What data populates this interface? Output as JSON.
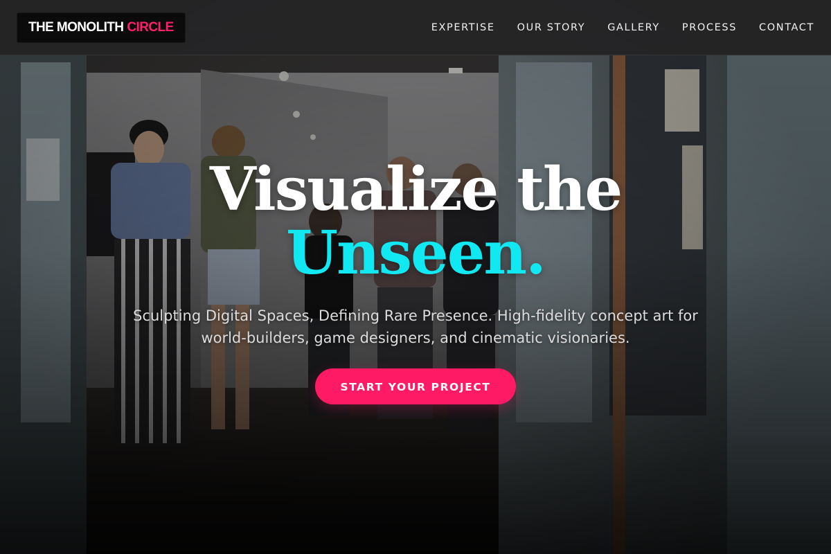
{
  "header": {
    "logo_primary": "THE MONOLITH",
    "logo_accent": "CIRCLE",
    "nav": [
      {
        "label": "EXPERTISE"
      },
      {
        "label": "OUR STORY"
      },
      {
        "label": "GALLERY"
      },
      {
        "label": "PROCESS"
      },
      {
        "label": "CONTACT"
      }
    ]
  },
  "hero": {
    "headline_line1": "Visualize the",
    "headline_line2": "Unseen.",
    "subtitle": "Sculpting Digital Spaces, Defining Rare Presence. High-fidelity concept art for world-builders, game designers, and cinematic visionaries.",
    "cta_label": "START YOUR PROJECT",
    "background_image": "gallery-crowd-photo"
  },
  "colors": {
    "accent_pink": "#ff1a66",
    "accent_cyan": "#12e8f2",
    "header_bg": "#28282a",
    "logo_bg": "#0b0b0c"
  }
}
